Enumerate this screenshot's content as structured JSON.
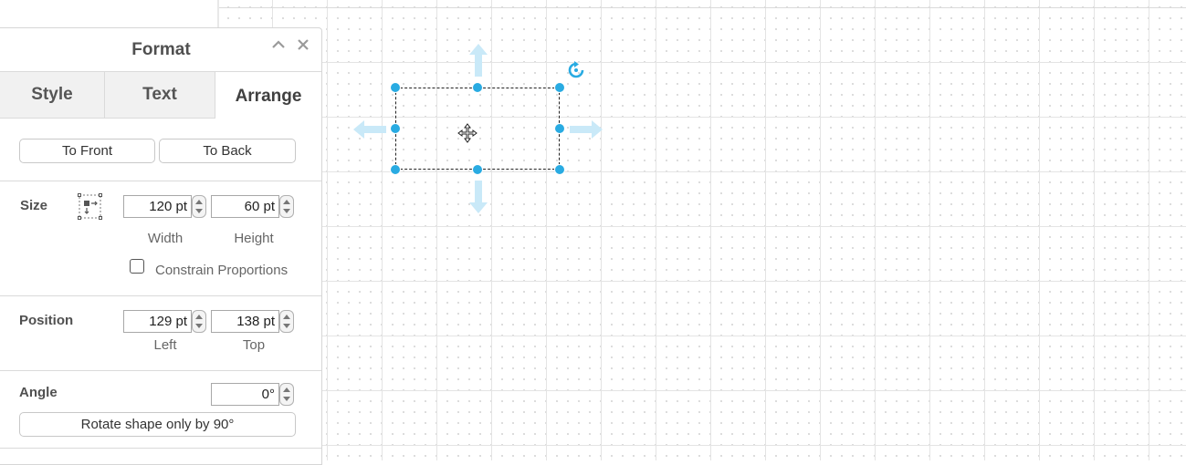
{
  "panel": {
    "title": "Format",
    "collapse_icon": "chevron-up-icon",
    "close_icon": "close-icon"
  },
  "tabs": [
    {
      "label": "Style",
      "active": false
    },
    {
      "label": "Text",
      "active": false
    },
    {
      "label": "Arrange",
      "active": true
    }
  ],
  "arrange": {
    "to_front": "To Front",
    "to_back": "To Back"
  },
  "size": {
    "label": "Size",
    "icon": "autosize-icon",
    "width_value": "120 pt",
    "height_value": "60 pt",
    "width_label": "Width",
    "height_label": "Height",
    "constrain_label": "Constrain Proportions",
    "constrain_checked": false
  },
  "position": {
    "label": "Position",
    "left_value": "129 pt",
    "top_value": "138 pt",
    "left_label": "Left",
    "top_label": "Top"
  },
  "angle": {
    "label": "Angle",
    "value": "0°",
    "rotate_button": "Rotate shape only by 90°"
  },
  "colors": {
    "handle": "#29abe2",
    "arrow": "#c9e9f8",
    "grid": "#e4e4e4"
  }
}
